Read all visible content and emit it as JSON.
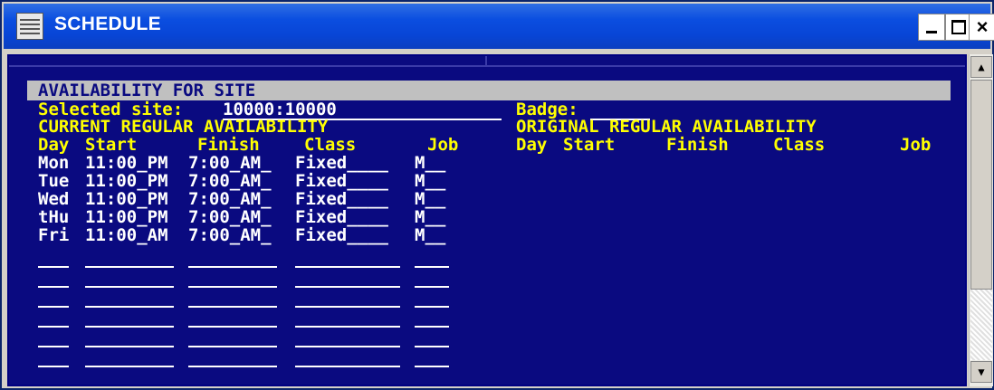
{
  "window": {
    "title": "SCHEDULE",
    "icon": "schedule-window-icon",
    "controls": {
      "minimize": "minimize-icon",
      "maximize": "maximize-icon",
      "close": "close-icon",
      "close_glyph": "×"
    }
  },
  "screen": {
    "heading": "AVAILABILITY FOR SITE",
    "selected_site_label": "Selected site:",
    "selected_site_value": "10000:10000",
    "badge_label": "Badge:",
    "badge_value": "",
    "current_section": "CURRENT REGULAR AVAILABILITY",
    "original_section": "ORIGINAL REGULAR AVAILABILITY",
    "columns": {
      "day": "Day",
      "start": "Start",
      "finish": "Finish",
      "class": "Class",
      "job": "Job"
    },
    "current_rows": [
      {
        "day": "Mon",
        "start": "11:00_PM",
        "finish": "7:00_AM_",
        "class": "Fixed____",
        "job": "M__"
      },
      {
        "day": "Tue",
        "start": "11:00_PM",
        "finish": "7:00_AM_",
        "class": "Fixed____",
        "job": "M__"
      },
      {
        "day": "Wed",
        "start": "11:00_PM",
        "finish": "7:00_AM_",
        "class": "Fixed____",
        "job": "M__"
      },
      {
        "day": "tHu",
        "start": "11:00_PM",
        "finish": "7:00_AM_",
        "class": "Fixed____",
        "job": "M__"
      },
      {
        "day": "Fri",
        "start": "11:00_AM",
        "finish": "7:00_AM_",
        "class": "Fixed____",
        "job": "M__"
      }
    ]
  },
  "colors": {
    "background": "#0a0a80",
    "field_label": "#ffff00",
    "field_value": "#ffffff",
    "heading_bar": "#c0c0c0",
    "titlebar": "#0b4ee0"
  },
  "scrollbar": {
    "up_glyph": "▲",
    "down_glyph": "▼"
  }
}
